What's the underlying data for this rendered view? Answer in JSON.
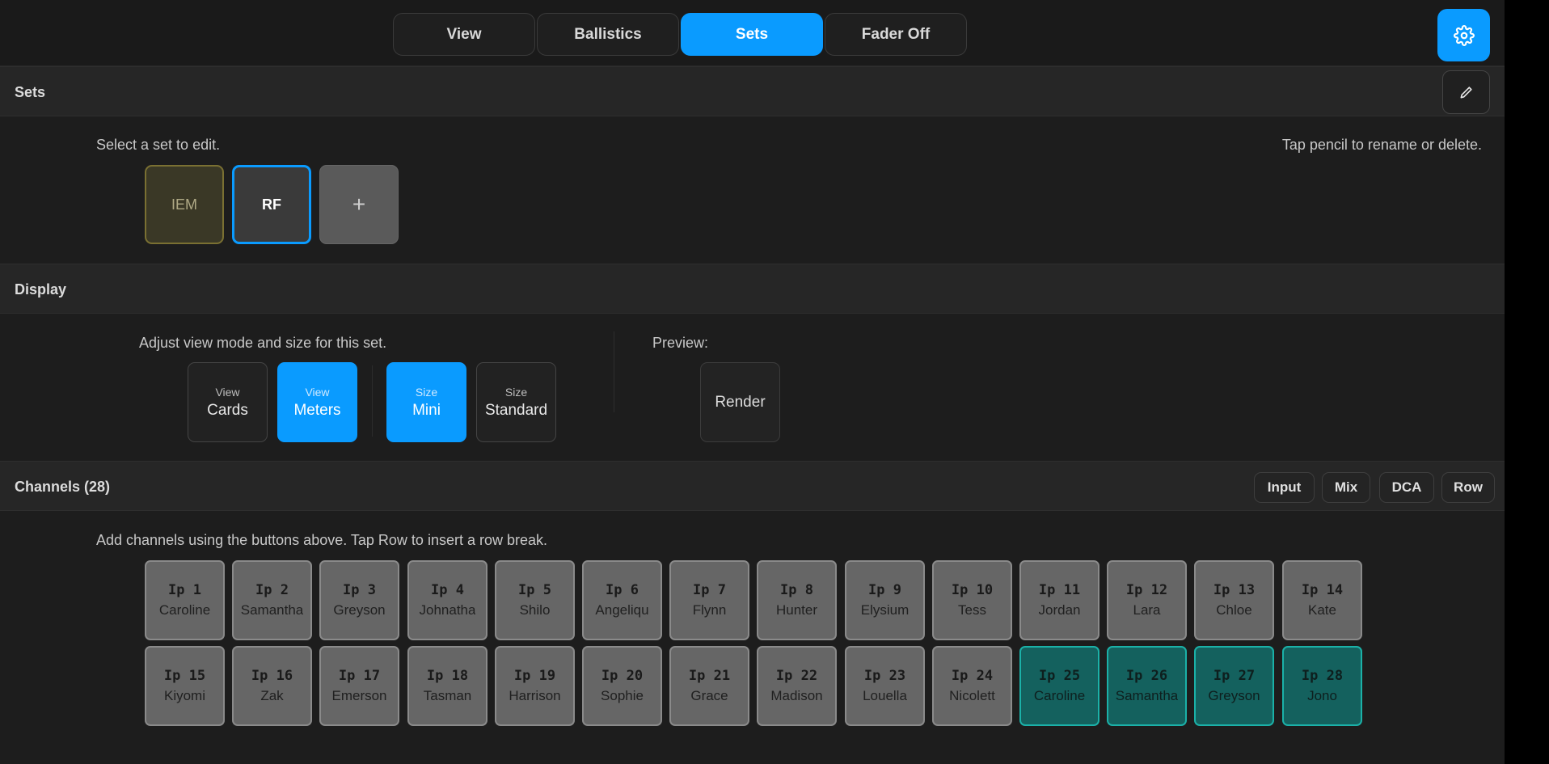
{
  "tabs": [
    "View",
    "Ballistics",
    "Sets",
    "Fader Off"
  ],
  "active_tab": "Sets",
  "accent_color": "#0a9bff",
  "teal_color": "#14615e",
  "sets_section": {
    "title": "Sets",
    "hint_left": "Select a set to edit.",
    "hint_right": "Tap pencil to rename or delete.",
    "sets": [
      "IEM",
      "RF"
    ],
    "add_label": "+",
    "selected": "RF"
  },
  "display_section": {
    "title": "Display",
    "hint": "Adjust view mode and size for this set.",
    "preview_label": "Preview:",
    "buttons": [
      {
        "small": "View",
        "big": "Cards",
        "active": false
      },
      {
        "small": "View",
        "big": "Meters",
        "active": true
      },
      {
        "small": "Size",
        "big": "Mini",
        "active": true
      },
      {
        "small": "Size",
        "big": "Standard",
        "active": false
      }
    ],
    "render_label": "Render"
  },
  "channels_section": {
    "title": "Channels (28)",
    "hint": "Add channels using the buttons above. Tap Row to insert a row break.",
    "type_buttons": [
      "Input",
      "Mix",
      "DCA",
      "Row"
    ],
    "channels": [
      {
        "id": "Ip 1",
        "name": "Caroline"
      },
      {
        "id": "Ip 2",
        "name": "Samantha"
      },
      {
        "id": "Ip 3",
        "name": "Greyson"
      },
      {
        "id": "Ip 4",
        "name": "Johnatha"
      },
      {
        "id": "Ip 5",
        "name": "Shilo"
      },
      {
        "id": "Ip 6",
        "name": "Angeliqu"
      },
      {
        "id": "Ip 7",
        "name": "Flynn"
      },
      {
        "id": "Ip 8",
        "name": "Hunter"
      },
      {
        "id": "Ip 9",
        "name": "Elysium"
      },
      {
        "id": "Ip 10",
        "name": "Tess"
      },
      {
        "id": "Ip 11",
        "name": "Jordan"
      },
      {
        "id": "Ip 12",
        "name": "Lara"
      },
      {
        "id": "Ip 13",
        "name": "Chloe"
      },
      {
        "id": "Ip 14",
        "name": "Kate"
      },
      {
        "id": "Ip 15",
        "name": "Kiyomi"
      },
      {
        "id": "Ip 16",
        "name": "Zak"
      },
      {
        "id": "Ip 17",
        "name": "Emerson"
      },
      {
        "id": "Ip 18",
        "name": "Tasman"
      },
      {
        "id": "Ip 19",
        "name": "Harrison"
      },
      {
        "id": "Ip 20",
        "name": "Sophie"
      },
      {
        "id": "Ip 21",
        "name": "Grace"
      },
      {
        "id": "Ip 22",
        "name": "Madison"
      },
      {
        "id": "Ip 23",
        "name": "Louella"
      },
      {
        "id": "Ip 24",
        "name": "Nicolett"
      },
      {
        "id": "Ip 25",
        "name": "Caroline",
        "highlight": true
      },
      {
        "id": "Ip 26",
        "name": "Samantha",
        "highlight": true
      },
      {
        "id": "Ip 27",
        "name": "Greyson",
        "highlight": true
      },
      {
        "id": "Ip 28",
        "name": "Jono",
        "highlight": true
      }
    ]
  },
  "icons": {
    "settings": "gear-icon",
    "edit": "pencil-icon"
  }
}
